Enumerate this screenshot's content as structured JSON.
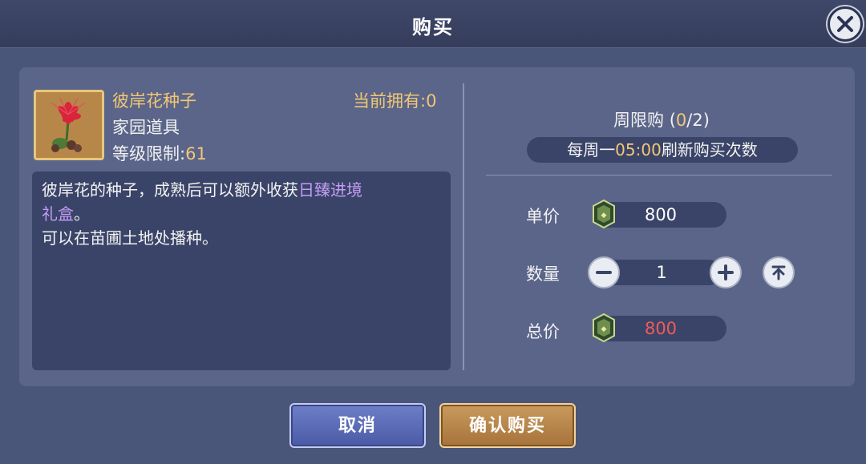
{
  "header": {
    "title": "购买"
  },
  "item": {
    "name": "彼岸花种子",
    "category": "家园道具",
    "level_label": "等级限制:",
    "level_value": "61",
    "owned_label": "当前拥有:",
    "owned_value": "0",
    "icon": "red-spider-lily-seed-icon",
    "description": {
      "line1_text": "彼岸花的种子，成熟后可以额外收获",
      "line1_highlight": "日臻进境",
      "line2_highlight": "礼盒",
      "line2_suffix": "。",
      "line3": "可以在苗圃土地处播种。"
    }
  },
  "limit": {
    "label": "周限购 (",
    "current": "0",
    "total": "/2)",
    "refresh_prefix": "每周一",
    "refresh_time": "05:00",
    "refresh_suffix": "刷新购买次数"
  },
  "purchase": {
    "unit_price_label": "单价",
    "unit_price": "800",
    "quantity_label": "数量",
    "quantity": "1",
    "total_label": "总价",
    "total_price": "800",
    "currency_icon": "jade-token-icon"
  },
  "buttons": {
    "cancel": "取消",
    "confirm": "确认购买"
  },
  "colors": {
    "accent_gold": "#f2c775",
    "highlight_purple": "#c49cf6",
    "total_red": "#f05a5a"
  }
}
